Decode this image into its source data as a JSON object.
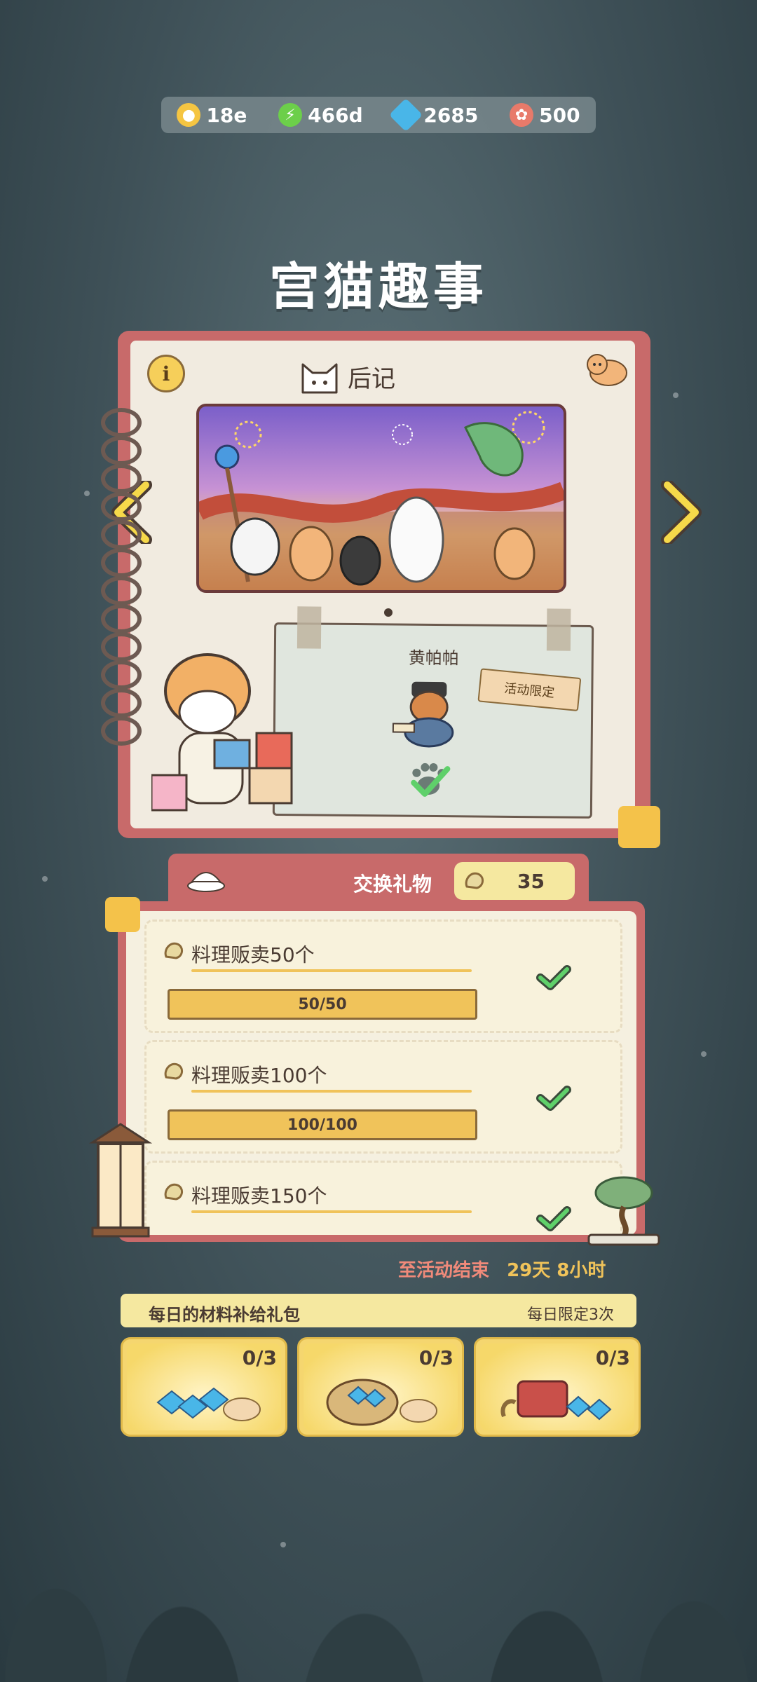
{
  "currency": [
    {
      "icon": "gold-coin-icon",
      "value": "18e",
      "color": "#f5c542"
    },
    {
      "icon": "lightning-icon",
      "value": "466d",
      "color": "#6ccf4a"
    },
    {
      "icon": "gem-icon",
      "value": "2685",
      "color": "#49b6e8"
    },
    {
      "icon": "ticket-icon",
      "value": "500",
      "color": "#e87a6a"
    }
  ],
  "title": "宫猫趣事",
  "chapter": {
    "label": "后记"
  },
  "reward_card": {
    "name": "黄帕帕",
    "tag": "活动限定"
  },
  "exchange": {
    "title": "交换礼物",
    "count": "35"
  },
  "quests": [
    {
      "title": "料理贩卖50个",
      "progress": "50/50",
      "fraction": 1.0,
      "done": true
    },
    {
      "title": "料理贩卖100个",
      "progress": "100/100",
      "fraction": 1.0,
      "done": true
    },
    {
      "title": "料理贩卖150个",
      "progress": "",
      "fraction": 1.0,
      "done": true
    }
  ],
  "countdown": {
    "label": "至活动结束",
    "value": "29天 8小时"
  },
  "daily": {
    "title": "每日的材料补给礼包",
    "limit": "每日限定3次"
  },
  "packs": [
    {
      "count": "0/3"
    },
    {
      "count": "0/3"
    },
    {
      "count": "0/3"
    }
  ],
  "colors": {
    "accent_red": "#c86a6a",
    "accent_yellow": "#f0c35a",
    "check_green": "#4caf50"
  }
}
